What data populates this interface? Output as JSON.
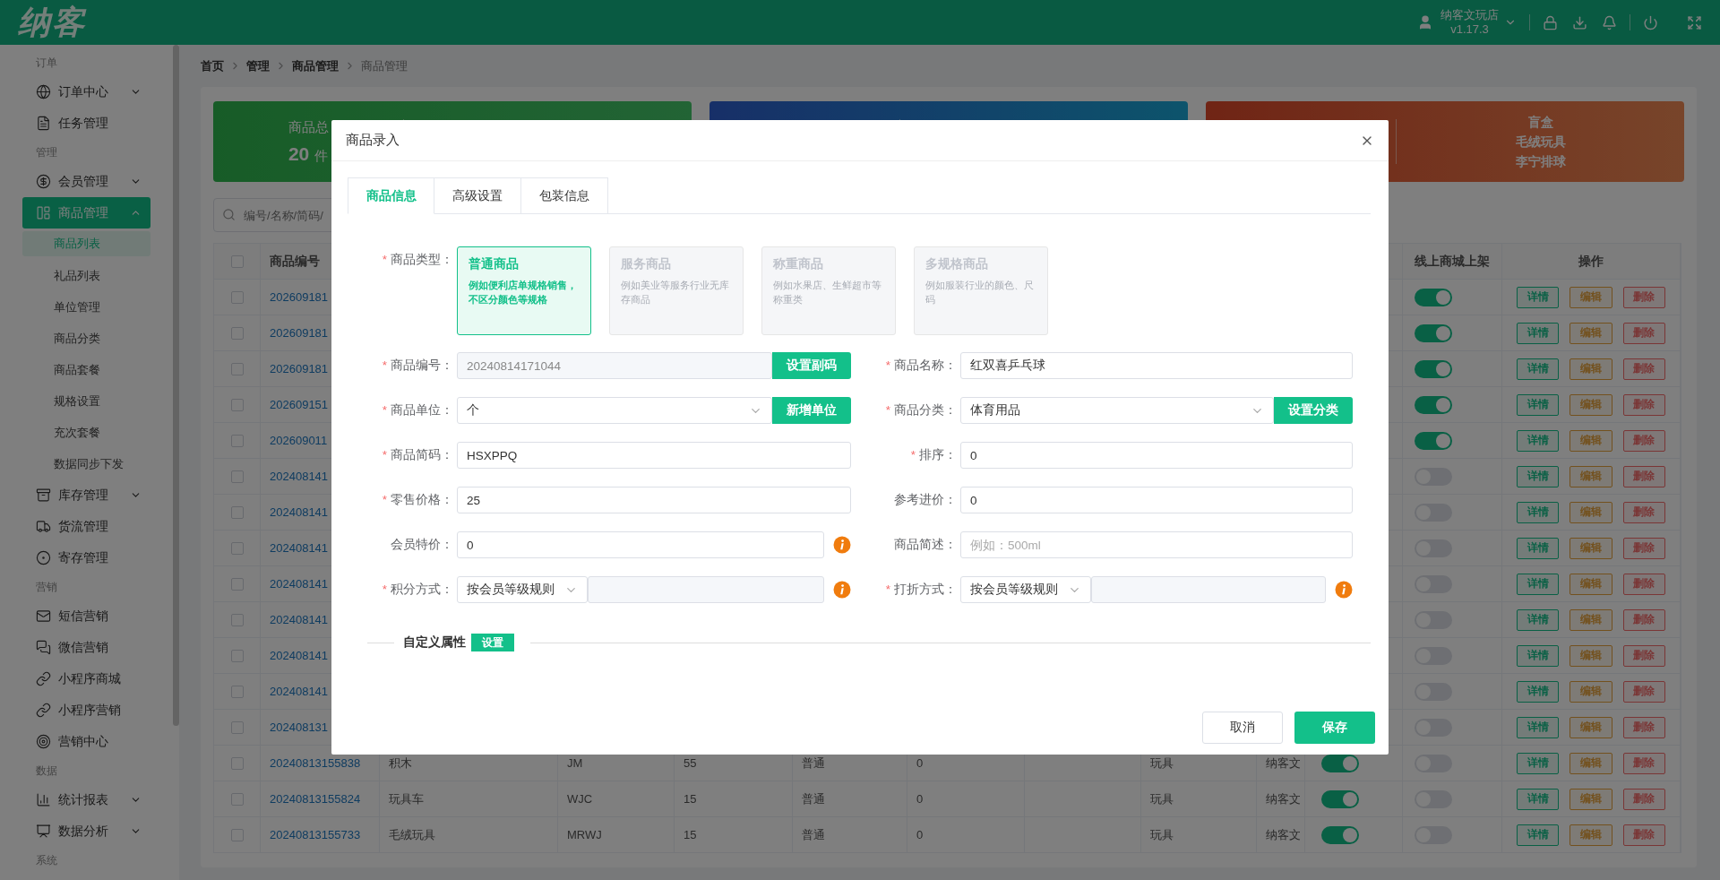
{
  "header": {
    "logo": "纳客",
    "user": {
      "name": "纳客文玩店",
      "version": "v1.17.3"
    }
  },
  "sidebar": {
    "sections": [
      {
        "label": "订单",
        "items": [
          {
            "label": "订单中心",
            "selected": false,
            "expanded": false
          },
          {
            "label": "任务管理",
            "selected": false
          }
        ]
      },
      {
        "label": "管理",
        "items": [
          {
            "label": "会员管理",
            "selected": false,
            "expanded": false
          },
          {
            "label": "商品管理",
            "selected": true,
            "expanded": true,
            "children": [
              {
                "label": "商品列表",
                "selected": true
              },
              {
                "label": "礼品列表",
                "selected": false
              },
              {
                "label": "单位管理",
                "selected": false
              },
              {
                "label": "商品分类",
                "selected": false
              },
              {
                "label": "商品套餐",
                "selected": false
              },
              {
                "label": "规格设置",
                "selected": false
              },
              {
                "label": "充次套餐",
                "selected": false
              },
              {
                "label": "数据同步下发",
                "selected": false
              }
            ]
          },
          {
            "label": "库存管理",
            "selected": false,
            "expanded": false
          },
          {
            "label": "货流管理",
            "selected": false
          },
          {
            "label": "寄存管理",
            "selected": false
          }
        ]
      },
      {
        "label": "营销",
        "items": [
          {
            "label": "短信营销",
            "selected": false
          },
          {
            "label": "微信营销",
            "selected": false
          },
          {
            "label": "小程序商城",
            "selected": false
          },
          {
            "label": "小程序营销",
            "selected": false
          },
          {
            "label": "营销中心",
            "selected": false
          }
        ]
      },
      {
        "label": "数据",
        "items": [
          {
            "label": "统计报表",
            "selected": false,
            "expanded": false
          },
          {
            "label": "数据分析",
            "selected": false,
            "expanded": false
          }
        ]
      },
      {
        "label": "系统"
      }
    ]
  },
  "breadcrumb": [
    "首页",
    "管理",
    "商品管理",
    "商品管理"
  ],
  "stat_cards": [
    {
      "label": "商品总",
      "value": "20",
      "unit": "件"
    },
    {
      "lines": [
        "盲盒",
        "毛绒玩具",
        "李宁排球"
      ]
    }
  ],
  "search": {
    "placeholder": "编号/名称/简码/"
  },
  "table": {
    "header": {
      "checked": false,
      "code": "商品编号",
      "online_shelf": "线上商城上架",
      "actions": "操作"
    },
    "rows": [
      {
        "checked": false,
        "code": "202609181",
        "online": true,
        "actions": [
          "详情",
          "编辑",
          "删除"
        ]
      },
      {
        "checked": false,
        "code": "202609181",
        "online": true,
        "actions": [
          "详情",
          "编辑",
          "删除"
        ]
      },
      {
        "checked": false,
        "code": "202609181",
        "online": true,
        "actions": [
          "详情",
          "编辑",
          "删除"
        ]
      },
      {
        "checked": false,
        "code": "202609151",
        "online": true,
        "actions": [
          "详情",
          "编辑",
          "删除"
        ]
      },
      {
        "checked": false,
        "code": "202609011",
        "online": true,
        "actions": [
          "详情",
          "编辑",
          "删除"
        ]
      },
      {
        "checked": false,
        "code": "202408141",
        "online": false,
        "actions": [
          "详情",
          "编辑",
          "删除"
        ]
      },
      {
        "checked": false,
        "code": "202408141",
        "online": false,
        "actions": [
          "详情",
          "编辑",
          "删除"
        ]
      },
      {
        "checked": false,
        "code": "202408141",
        "online": false,
        "actions": [
          "详情",
          "编辑",
          "删除"
        ]
      },
      {
        "checked": false,
        "code": "202408141",
        "online": false,
        "actions": [
          "详情",
          "编辑",
          "删除"
        ]
      },
      {
        "checked": false,
        "code": "202408141",
        "online": false,
        "actions": [
          "详情",
          "编辑",
          "删除"
        ]
      },
      {
        "checked": false,
        "code": "202408141",
        "online": false,
        "actions": [
          "详情",
          "编辑",
          "删除"
        ]
      },
      {
        "checked": false,
        "code": "202408141",
        "online": false,
        "actions": [
          "详情",
          "编辑",
          "删除"
        ]
      },
      {
        "checked": false,
        "code": "202408131",
        "online": false,
        "actions": [
          "详情",
          "编辑",
          "删除"
        ]
      },
      {
        "checked": false,
        "code": "20240813155838",
        "column_3": "积木",
        "column_4": "JM",
        "column_5": "55",
        "column_6": "普通",
        "column_7": "0",
        "column_9": "玩具",
        "column_10": "纳客文",
        "column_11_on": true,
        "online": false,
        "actions": [
          "详情",
          "编辑",
          "删除"
        ]
      },
      {
        "checked": false,
        "code": "20240813155824",
        "column_3": "玩具车",
        "column_4": "WJC",
        "column_5": "15",
        "column_6": "普通",
        "column_7": "0",
        "column_9": "玩具",
        "column_10": "纳客文",
        "column_11_on": true,
        "online": false,
        "actions": [
          "详情",
          "编辑",
          "删除"
        ]
      },
      {
        "checked": false,
        "code": "20240813155733",
        "column_3": "毛绒玩具",
        "column_4": "MRWJ",
        "column_5": "15",
        "column_6": "普通",
        "column_7": "0",
        "column_9": "玩具",
        "column_10": "纳客文",
        "column_11_on": true,
        "online": false,
        "actions": [
          "详情",
          "编辑",
          "删除"
        ]
      }
    ]
  },
  "modal": {
    "title": "商品录入",
    "tabs": [
      {
        "label": "商品信息",
        "selected": true
      },
      {
        "label": "高级设置",
        "selected": false
      },
      {
        "label": "包装信息",
        "selected": false
      }
    ],
    "type_field": {
      "marker": "*",
      "label": "商品类型：",
      "options": [
        {
          "title": "普通商品",
          "description": "例如便利店单规格销售，不区分颜色等规格",
          "selected": true
        },
        {
          "title": "服务商品",
          "description": "例如美业等服务行业无库存商品",
          "selected": false
        },
        {
          "title": "称重商品",
          "description": "例如水果店、生鲜超市等称重类",
          "selected": false
        },
        {
          "title": "多规格商品",
          "description": "例如服装行业的颜色、尺码",
          "selected": false
        }
      ]
    },
    "fields": [
      {
        "marker": "*",
        "label": "商品编号：",
        "kind": "readonly",
        "value": "20240814171044",
        "button": "设置副码"
      },
      {
        "marker": "*",
        "label": "商品名称：",
        "kind": "input",
        "value": "红双喜乒乓球"
      },
      {
        "marker": "*",
        "label": "商品单位：",
        "kind": "select",
        "value": "个",
        "button": "新增单位"
      },
      {
        "marker": "*",
        "label": "商品分类：",
        "kind": "select",
        "value": "体育用品",
        "button": "设置分类"
      },
      {
        "marker": "*",
        "label": "商品简码：",
        "kind": "input",
        "value": "HSXPPQ"
      },
      {
        "marker": "*",
        "label": "排序：",
        "kind": "input",
        "value": "0"
      },
      {
        "marker": "*",
        "label": "零售价格：",
        "kind": "input",
        "value": "25"
      },
      {
        "label": "参考进价：",
        "kind": "input",
        "value": "0"
      },
      {
        "label": "会员特价：",
        "kind": "input",
        "value": "0",
        "info": true
      },
      {
        "label": "商品简述：",
        "kind": "input",
        "placeholder": "例如：500ml"
      },
      {
        "marker": "*",
        "label": "积分方式：",
        "kind": "select_pair",
        "value": "按会员等级规则",
        "info": true
      },
      {
        "marker": "*",
        "label": "打折方式：",
        "kind": "select_pair",
        "value": "按会员等级规则",
        "info": true
      }
    ],
    "custom_attributes": {
      "label": "自定义属性",
      "button": "设置"
    },
    "buttons": [
      "取消",
      "保存"
    ]
  }
}
